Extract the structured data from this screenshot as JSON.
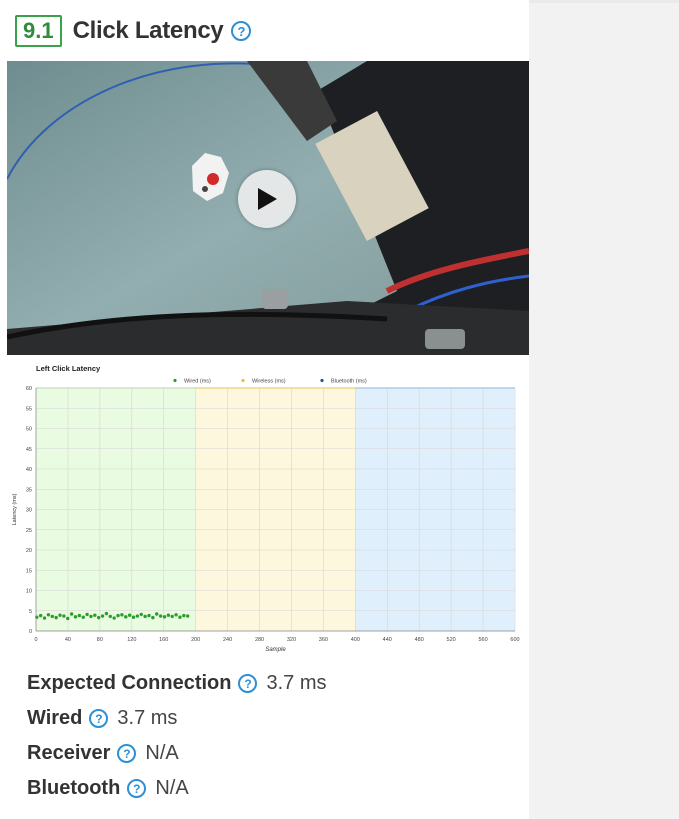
{
  "section": {
    "number": "9.1",
    "title": "Click Latency"
  },
  "video": {
    "control": "play-icon"
  },
  "chart_data": {
    "type": "scatter",
    "title": "Left Click Latency",
    "xlabel": "Sample",
    "ylabel": "Latency (ms)",
    "xlim": [
      0,
      600
    ],
    "ylim": [
      0,
      60
    ],
    "xticks": [
      0,
      40,
      80,
      120,
      160,
      200,
      240,
      280,
      320,
      360,
      400,
      440,
      480,
      520,
      560,
      600
    ],
    "yticks": [
      0,
      5,
      10,
      15,
      20,
      25,
      30,
      35,
      40,
      45,
      50,
      55,
      60
    ],
    "grid": true,
    "legend_position": "top",
    "regions": [
      {
        "name": "Wired",
        "x": [
          0,
          200
        ],
        "color": "#e9fbe0"
      },
      {
        "name": "Wireless",
        "x": [
          200,
          400
        ],
        "color": "#fdf7dd"
      },
      {
        "name": "Bluetooth",
        "x": [
          400,
          600
        ],
        "color": "#e0effc"
      }
    ],
    "series": [
      {
        "name": "Wired (ms)",
        "color": "#2a9d2a",
        "x_range": [
          1,
          190
        ],
        "y": [
          3.4,
          3.8,
          3.2,
          4.0,
          3.6,
          3.3,
          3.9,
          3.7,
          3.1,
          4.2,
          3.5,
          3.8,
          3.4,
          4.1,
          3.6,
          3.9,
          3.3,
          3.7,
          4.3,
          3.6,
          3.2,
          3.8,
          4.0,
          3.5,
          3.9,
          3.4,
          3.7,
          4.1,
          3.6,
          3.8,
          3.3,
          4.2,
          3.7,
          3.5,
          3.9,
          3.6,
          4.0,
          3.4,
          3.8,
          3.7
        ]
      },
      {
        "name": "Wireless (ms)",
        "color": "#f0c020",
        "y": []
      },
      {
        "name": "Bluetooth (ms)",
        "color": "#2a4f8f",
        "y": []
      }
    ]
  },
  "specs": [
    {
      "label": "Expected Connection",
      "value": "3.7 ms"
    },
    {
      "label": "Wired",
      "value": "3.7 ms"
    },
    {
      "label": "Receiver",
      "value": "N/A"
    },
    {
      "label": "Bluetooth",
      "value": "N/A"
    }
  ]
}
